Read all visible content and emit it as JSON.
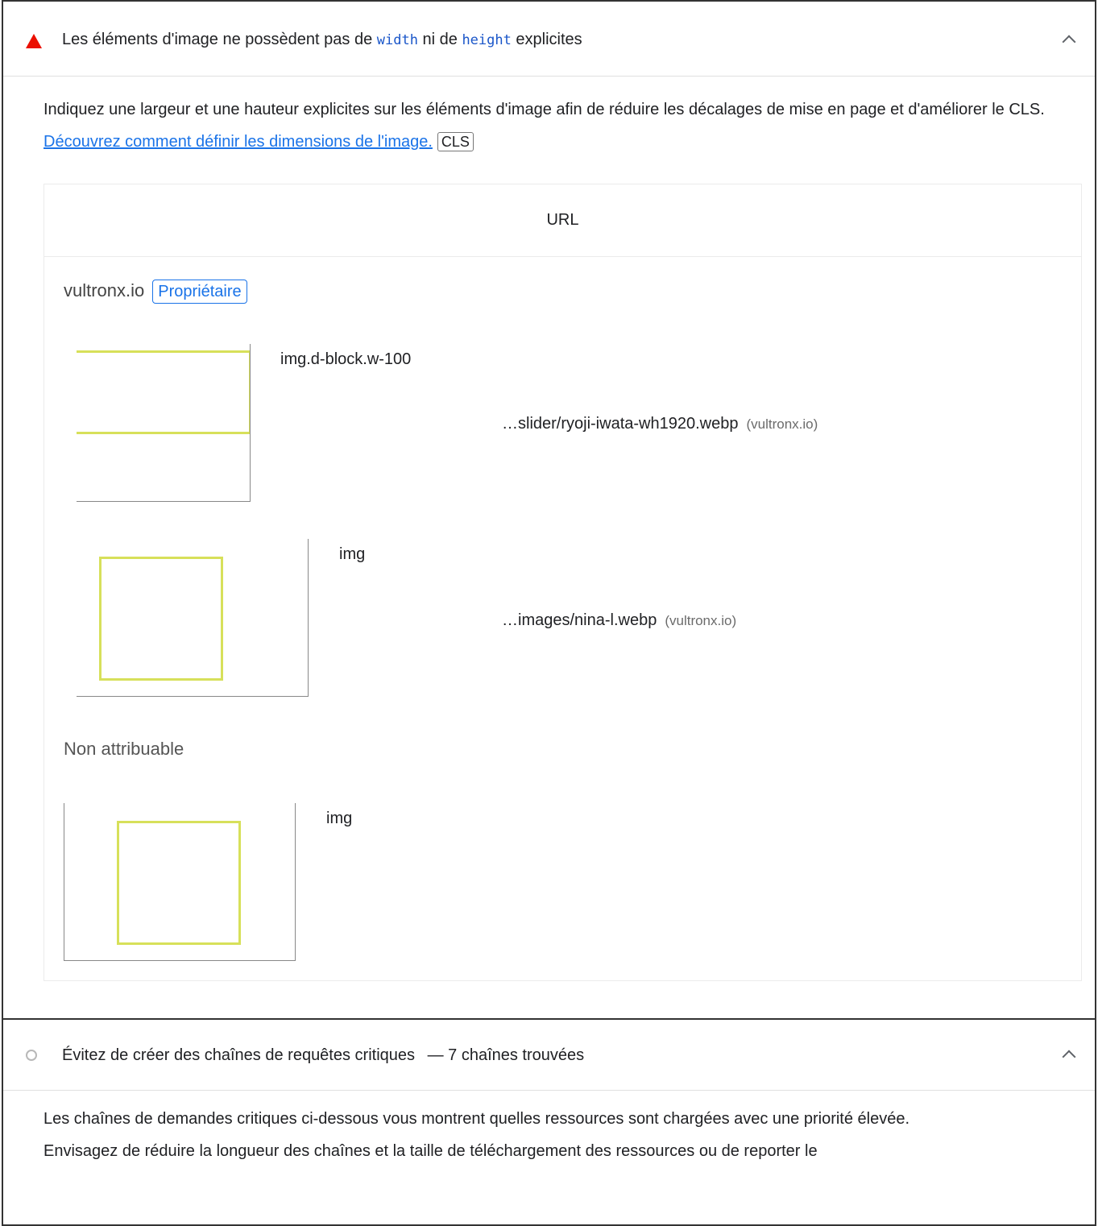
{
  "audit1": {
    "title_part1": "Les éléments d'image ne possèdent pas de",
    "code_width": "width",
    "title_part2": "ni de",
    "code_height": "height",
    "title_part3": "explicites",
    "description_text": "Indiquez une largeur et une hauteur explicites sur les éléments d'image afin de réduire les décalages de mise en page et d'améliorer le CLS.",
    "description_link": "Découvrez comment définir les dimensions de l'image.",
    "metric_tag": "CLS",
    "status_color": "#eb0f00",
    "table": {
      "column_header": "URL",
      "groups": [
        {
          "entity": "vultronx.io",
          "badge": "Propriétaire",
          "rows": [
            {
              "selector": "img.d-block.w-100",
              "url": "…slider/ryoji-iwata-wh1920.webp",
              "origin": "(vultronx.io)"
            },
            {
              "selector": "img",
              "url": "…images/nina-l.webp",
              "origin": "(vultronx.io)"
            }
          ]
        },
        {
          "entity": "Non attribuable",
          "rows": [
            {
              "selector": "img"
            }
          ]
        }
      ]
    }
  },
  "audit2": {
    "title": "Évitez de créer des chaînes de requêtes critiques",
    "display_value": "— 7 chaînes trouvées",
    "description_line1": "Les chaînes de demandes critiques ci-dessous vous montrent quelles ressources sont chargées avec une priorité élevée.",
    "description_line2": "Envisagez de réduire la longueur des chaînes et la taille de téléchargement des ressources ou de reporter le"
  },
  "colors": {
    "link": "#1a73e8",
    "highlight_outline": "#d7e05a",
    "code": "#1a56c9"
  },
  "icons": [
    "fail-triangle-icon",
    "chevron-up-icon",
    "informative-circle-icon"
  ]
}
